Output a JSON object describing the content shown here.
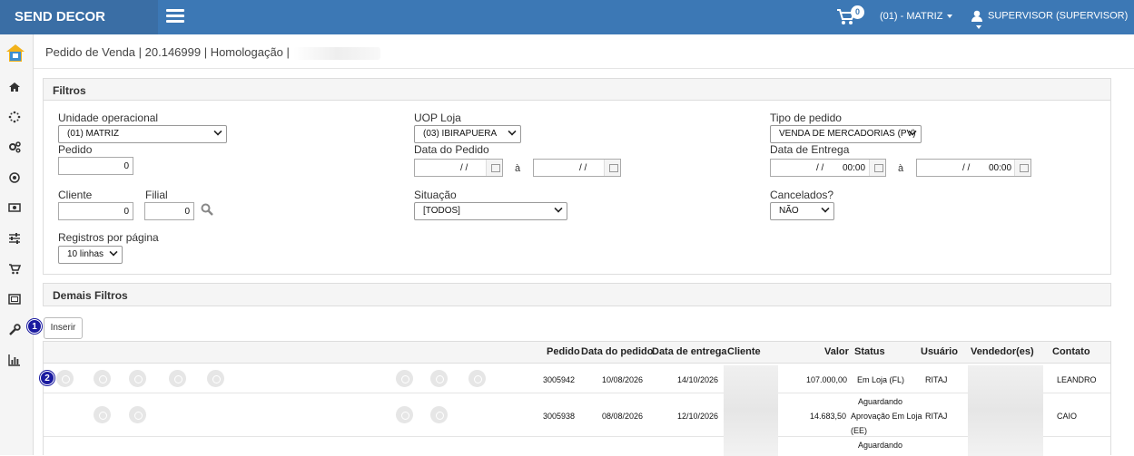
{
  "app": {
    "brand": "SEND DECOR",
    "cart_count": "0",
    "branch": "(01) - MATRIZ",
    "user": "SUPERVISOR (SUPERVISOR)"
  },
  "breadcrumb": "Pedido de Venda | 20.146999 | Homologação |",
  "filters": {
    "title": "Filtros",
    "unidade_label": "Unidade operacional",
    "unidade_value": "(01) MATRIZ",
    "uop_label": "UOP Loja",
    "uop_value": "(03) IBIRAPUERA",
    "tipo_label": "Tipo de pedido",
    "tipo_value": "VENDA DE MERCADORIAS (PV)",
    "pedido_label": "Pedido",
    "pedido_value": "0",
    "data_pedido_label": "Data do Pedido",
    "date_blank": "/ /",
    "date_sep": "à",
    "data_entrega_label": "Data de Entrega",
    "time_value": "00:00",
    "cliente_label": "Cliente",
    "cliente_value": "0",
    "filial_label": "Filial",
    "filial_value": "0",
    "situacao_label": "Situação",
    "situacao_value": "[TODOS]",
    "cancelados_label": "Cancelados?",
    "cancelados_value": "NÃO",
    "registros_label": "Registros por página",
    "registros_value": "10 linhas"
  },
  "demais": {
    "title": "Demais Filtros"
  },
  "insert_button": "Inserir",
  "badges": {
    "one": "1",
    "two": "2"
  },
  "table": {
    "headers": {
      "pedido": "Pedido",
      "data_pedido": "Data do pedido",
      "data_entrega": "Data de entrega",
      "cliente": "Cliente",
      "valor": "Valor",
      "status": "Status",
      "usuario": "Usuário",
      "vendedor": "Vendedor(es)",
      "contato": "Contato"
    },
    "rows": [
      {
        "pedido": "3005942",
        "data_pedido": "10/08/2026",
        "data_entrega": "14/10/2026",
        "valor": "107.000,00",
        "status": "Em Loja (FL)",
        "usuario": "RITAJ",
        "contato": "LEANDRO"
      },
      {
        "pedido": "3005938",
        "data_pedido": "08/08/2026",
        "data_entrega": "12/10/2026",
        "valor": "14.683,50",
        "status1": "Aguardando",
        "status2": "Aprovação Em Loja",
        "status3": "(EE)",
        "usuario": "RITAJ",
        "contato": "CAIO"
      },
      {
        "status1": "Aguardando"
      }
    ]
  },
  "colors": {
    "topbar": "#3c78b5",
    "brand_bg": "#3a6ea5",
    "badge": "#1a1aa0"
  }
}
